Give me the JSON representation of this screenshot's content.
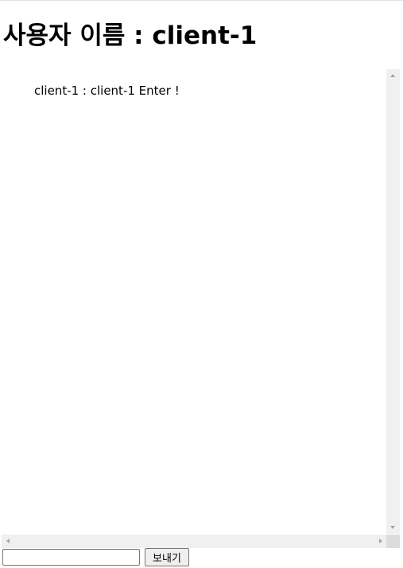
{
  "header": {
    "title": "사용자 이름 : client-1"
  },
  "chat": {
    "messages": [
      "client-1 : client-1 Enter !"
    ]
  },
  "composer": {
    "input_value": "",
    "input_placeholder": "",
    "send_label": "보내기"
  },
  "colors": {
    "scrollbar_track": "#f0f0f0",
    "scrollbar_arrow": "#a3a3a3",
    "button_bg": "#efefef",
    "border": "#767676"
  },
  "icons": [
    "scroll-up-arrow-icon",
    "scroll-down-arrow-icon",
    "scroll-left-arrow-icon",
    "scroll-right-arrow-icon"
  ]
}
